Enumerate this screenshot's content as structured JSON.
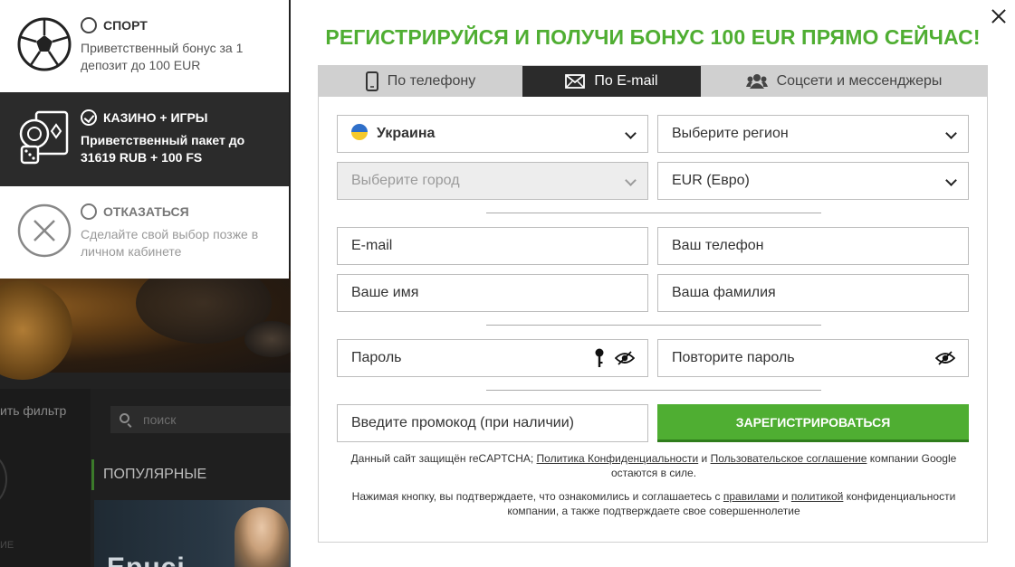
{
  "background": {
    "filter_text": "ить фильтр",
    "search_placeholder": "поиск",
    "popular_label": "ПОПУЛЯРНЫЕ",
    "side_small_text": "ИЕ",
    "game_card_text": "Epuci"
  },
  "bonus": {
    "items": [
      {
        "title": "СПОРТ",
        "desc": "Приветственный бонус за 1 депозит до 100 EUR",
        "selected": false,
        "icon": "soccer-ball-icon"
      },
      {
        "title": "КАЗИНО + ИГРЫ",
        "desc": "Приветственный пакет до 31619 RUB + 100 FS",
        "selected": true,
        "icon": "casino-cards-icon"
      },
      {
        "title": "ОТКАЗАТЬСЯ",
        "desc": "Сделайте свой выбор позже в личном кабинете",
        "selected": false,
        "icon": "decline-x-icon"
      }
    ]
  },
  "modal": {
    "title": "РЕГИСТРИРУЙСЯ И ПОЛУЧИ БОНУС 100 EUR ПРЯМО СЕЙЧАС!",
    "tabs": [
      {
        "label": "По телефону",
        "icon": "phone-icon"
      },
      {
        "label": "По E-mail",
        "icon": "envelope-icon",
        "active": true
      },
      {
        "label": "Соцсети и мессенджеры",
        "icon": "users-icon"
      }
    ],
    "country": "Украина",
    "region_placeholder": "Выберите регион",
    "city_placeholder": "Выберите город",
    "currency": "EUR (Евро)",
    "email_placeholder": "E-mail",
    "phone_placeholder": "Ваш телефон",
    "name_placeholder": "Ваше имя",
    "surname_placeholder": "Ваша фамилия",
    "password_placeholder": "Пароль",
    "repeat_password_placeholder": "Повторите пароль",
    "promo_placeholder": "Введите промокод (при наличии)",
    "register_label": "ЗАРЕГИСТРИРОВАТЬСЯ",
    "recaptcha": {
      "part1": "Данный сайт защищён reCAPTCHA;",
      "privacy_link": "Политика Конфиденциальности",
      "and": "и",
      "terms_link": "Пользовательское соглашение",
      "part2": "компании Google остаются в силе."
    },
    "consent": {
      "part1": "Нажимая кнопку, вы подтверждаете, что ознакомились и соглашаетесь с",
      "rules_link": "правилами",
      "and": "и",
      "policy_link": "политикой",
      "part2": "конфиденциальности компании, а также подтверждаете свое совершеннолетие"
    }
  },
  "colors": {
    "accent_green": "#4fae32",
    "dark_tab": "#2b2b2b"
  }
}
